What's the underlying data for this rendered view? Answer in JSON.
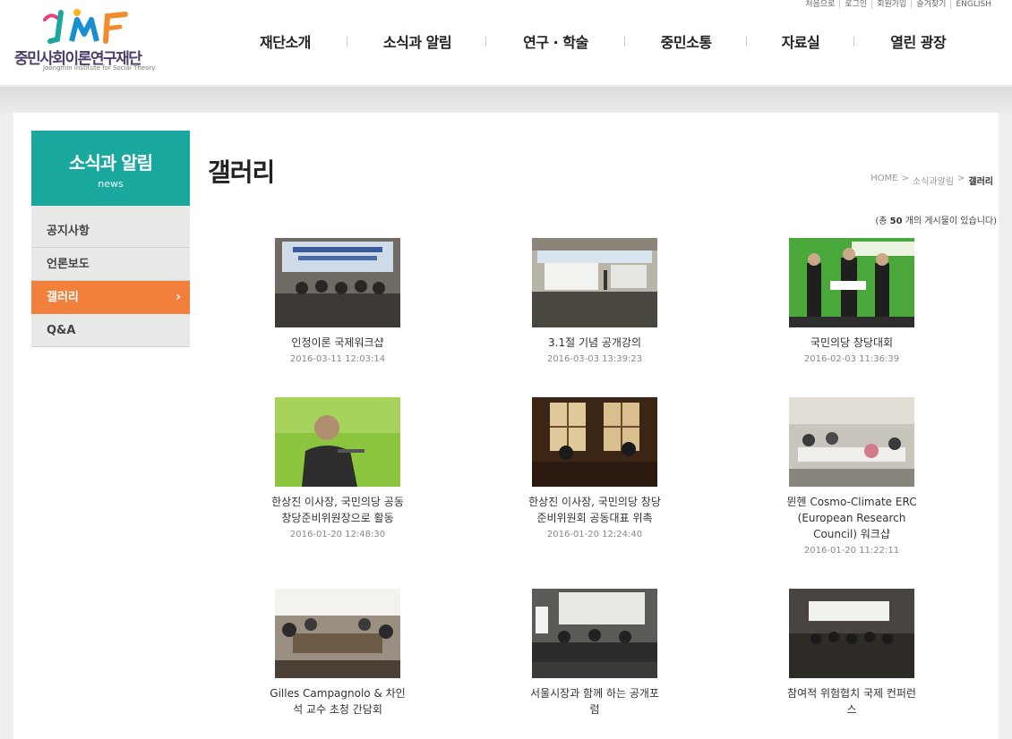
{
  "header": {
    "logo_text": "중민사회이론연구재단",
    "logo_sub": "Joongmin Institute for Social Theory",
    "util_links": [
      "처음으로",
      "로그인",
      "회원가입",
      "즐겨찾기",
      "ENGLISH"
    ],
    "nav": [
      "재단소개",
      "소식과 알림",
      "연구 · 학술",
      "중민소통",
      "자료실",
      "열린 광장"
    ]
  },
  "sidebar": {
    "title": "소식과 알림",
    "subtitle": "news",
    "items": [
      {
        "label": "공지사항",
        "active": false
      },
      {
        "label": "언론보도",
        "active": false
      },
      {
        "label": "갤러리",
        "active": true
      },
      {
        "label": "Q&A",
        "active": false
      }
    ],
    "active_arrow": "›"
  },
  "main": {
    "page_title": "갤러리",
    "breadcrumb": [
      "HOME",
      "소식과알림",
      "갤러리"
    ],
    "breadcrumb_sep": ">",
    "count_pre": "(총",
    "count": "50",
    "count_post": "개의 게시물이 있습니다)"
  },
  "gallery": [
    {
      "title": "인정이론 국제워크샵",
      "date": "2016-03-11 12:03:14"
    },
    {
      "title": "3.1절 기념 공개강의",
      "date": "2016-03-03 13:39:23"
    },
    {
      "title": "국민의당 창당대회",
      "date": "2016-02-03 11:36:39"
    },
    {
      "title": "한상진 이사장, 국민의당 공동 창당준비위원장으로 활동",
      "date": "2016-01-20 12:48:30"
    },
    {
      "title": "한상진 이사장, 국민의당 창당준비위원회 공동대표 위촉",
      "date": "2016-01-20 12:24:40"
    },
    {
      "title": "뮌헨 Cosmo-Climate ERC (European Research Council) 워크샵",
      "date": "2016-01-20 11:22:11"
    },
    {
      "title": "Gilles Campagnolo & 차인석 교수 초청 간담회",
      "date": ""
    },
    {
      "title": "서울시장과 함께 하는 공개포럼",
      "date": ""
    },
    {
      "title": "참여적 위험협치 국제 컨퍼런스",
      "date": ""
    }
  ],
  "colors": {
    "teal": "#1aa79e",
    "orange": "#f0803c"
  }
}
